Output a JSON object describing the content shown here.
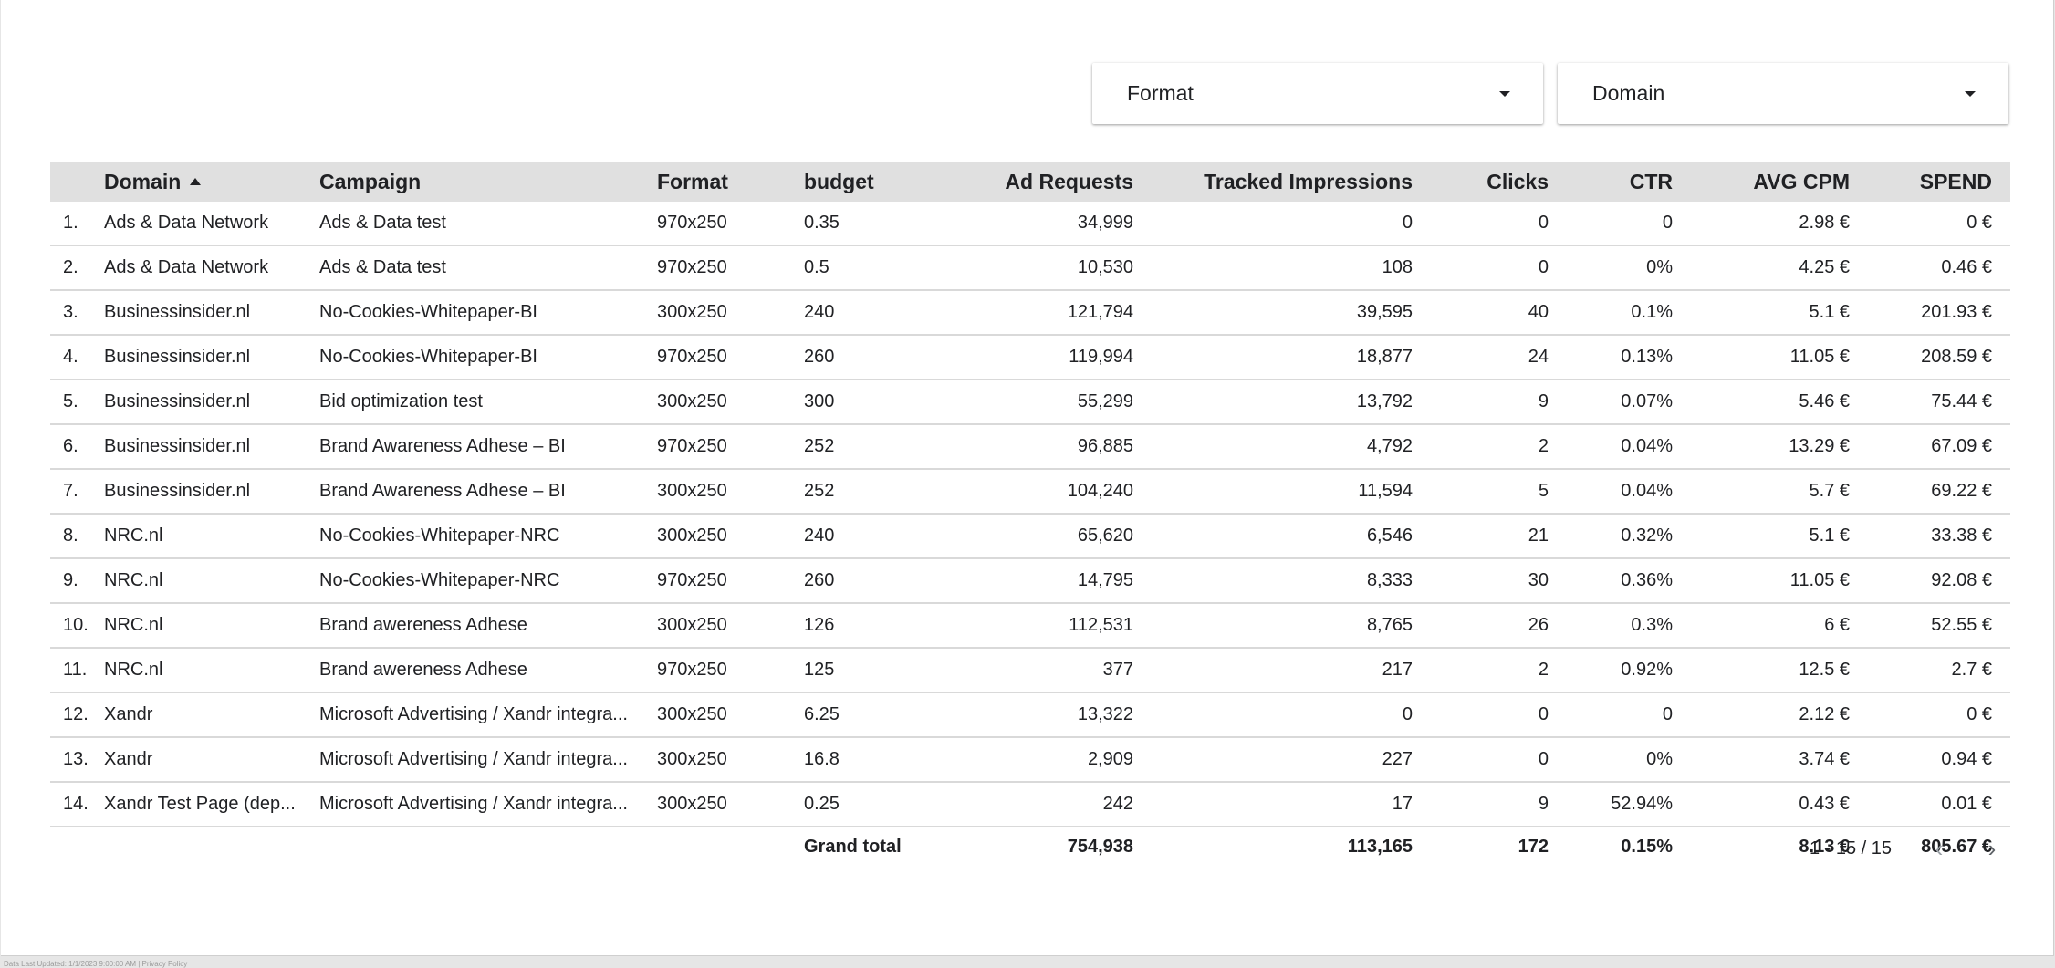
{
  "filters": {
    "format_label": "Format",
    "domain_label": "Domain"
  },
  "table": {
    "columns": {
      "domain": "Domain",
      "campaign": "Campaign",
      "format": "Format",
      "budget": "budget",
      "ad_requests": "Ad Requests",
      "tracked_impressions": "Tracked Impressions",
      "clicks": "Clicks",
      "ctr": "CTR",
      "avg_cpm": "AVG CPM",
      "spend": "SPEND"
    },
    "sort": {
      "column": "Domain",
      "direction": "ascending"
    },
    "rows": [
      {
        "idx": "1.",
        "domain": "Ads & Data Network",
        "campaign": "Ads & Data test",
        "format": "970x250",
        "budget": "0.35",
        "req": "34,999",
        "imp": "0",
        "clicks": "0",
        "ctr": "0",
        "cpm": "2.98 €",
        "spend": "0 €"
      },
      {
        "idx": "2.",
        "domain": "Ads & Data Network",
        "campaign": "Ads & Data test",
        "format": "970x250",
        "budget": "0.5",
        "req": "10,530",
        "imp": "108",
        "clicks": "0",
        "ctr": "0%",
        "cpm": "4.25 €",
        "spend": "0.46 €"
      },
      {
        "idx": "3.",
        "domain": "Businessinsider.nl",
        "campaign": "No-Cookies-Whitepaper-BI",
        "format": "300x250",
        "budget": "240",
        "req": "121,794",
        "imp": "39,595",
        "clicks": "40",
        "ctr": "0.1%",
        "cpm": "5.1 €",
        "spend": "201.93 €"
      },
      {
        "idx": "4.",
        "domain": "Businessinsider.nl",
        "campaign": "No-Cookies-Whitepaper-BI",
        "format": "970x250",
        "budget": "260",
        "req": "119,994",
        "imp": "18,877",
        "clicks": "24",
        "ctr": "0.13%",
        "cpm": "11.05 €",
        "spend": "208.59 €"
      },
      {
        "idx": "5.",
        "domain": "Businessinsider.nl",
        "campaign": "Bid optimization test",
        "format": "300x250",
        "budget": "300",
        "req": "55,299",
        "imp": "13,792",
        "clicks": "9",
        "ctr": "0.07%",
        "cpm": "5.46 €",
        "spend": "75.44 €"
      },
      {
        "idx": "6.",
        "domain": "Businessinsider.nl",
        "campaign": "Brand Awareness Adhese – BI",
        "format": "970x250",
        "budget": "252",
        "req": "96,885",
        "imp": "4,792",
        "clicks": "2",
        "ctr": "0.04%",
        "cpm": "13.29 €",
        "spend": "67.09 €"
      },
      {
        "idx": "7.",
        "domain": "Businessinsider.nl",
        "campaign": "Brand Awareness Adhese – BI",
        "format": "300x250",
        "budget": "252",
        "req": "104,240",
        "imp": "11,594",
        "clicks": "5",
        "ctr": "0.04%",
        "cpm": "5.7 €",
        "spend": "69.22 €"
      },
      {
        "idx": "8.",
        "domain": "NRC.nl",
        "campaign": "No-Cookies-Whitepaper-NRC",
        "format": "300x250",
        "budget": "240",
        "req": "65,620",
        "imp": "6,546",
        "clicks": "21",
        "ctr": "0.32%",
        "cpm": "5.1 €",
        "spend": "33.38 €"
      },
      {
        "idx": "9.",
        "domain": "NRC.nl",
        "campaign": "No-Cookies-Whitepaper-NRC",
        "format": "970x250",
        "budget": "260",
        "req": "14,795",
        "imp": "8,333",
        "clicks": "30",
        "ctr": "0.36%",
        "cpm": "11.05 €",
        "spend": "92.08 €"
      },
      {
        "idx": "10.",
        "domain": "NRC.nl",
        "campaign": "Brand awereness Adhese",
        "format": "300x250",
        "budget": "126",
        "req": "112,531",
        "imp": "8,765",
        "clicks": "26",
        "ctr": "0.3%",
        "cpm": "6 €",
        "spend": "52.55 €"
      },
      {
        "idx": "11.",
        "domain": "NRC.nl",
        "campaign": "Brand awereness Adhese",
        "format": "970x250",
        "budget": "125",
        "req": "377",
        "imp": "217",
        "clicks": "2",
        "ctr": "0.92%",
        "cpm": "12.5 €",
        "spend": "2.7 €"
      },
      {
        "idx": "12.",
        "domain": "Xandr",
        "campaign": "Microsoft Advertising / Xandr integra...",
        "format": "300x250",
        "budget": "6.25",
        "req": "13,322",
        "imp": "0",
        "clicks": "0",
        "ctr": "0",
        "cpm": "2.12 €",
        "spend": "0 €"
      },
      {
        "idx": "13.",
        "domain": "Xandr",
        "campaign": "Microsoft Advertising / Xandr integra...",
        "format": "300x250",
        "budget": "16.8",
        "req": "2,909",
        "imp": "227",
        "clicks": "0",
        "ctr": "0%",
        "cpm": "3.74 €",
        "spend": "0.94 €"
      },
      {
        "idx": "14.",
        "domain": "Xandr Test Page (dep...",
        "campaign": "Microsoft Advertising / Xandr integra...",
        "format": "300x250",
        "budget": "0.25",
        "req": "242",
        "imp": "17",
        "clicks": "9",
        "ctr": "52.94%",
        "cpm": "0.43 €",
        "spend": "0.01 €"
      }
    ],
    "totals": {
      "label": "Grand total",
      "req": "754,938",
      "imp": "113,165",
      "clicks": "172",
      "ctr": "0.15%",
      "cpm": "8.13 €",
      "spend": "805.67 €"
    }
  },
  "pagination": {
    "range": "1 - 15 / 15",
    "prev_icon": "chevron-left-icon",
    "next_icon": "chevron-right-icon"
  },
  "footer": {
    "note": "Data Last Updated: 1/1/2023 9:00:00 AM | Privacy Policy"
  },
  "colors": {
    "header_bg": "#e0e0e0",
    "row_divider": "#d9d9d9",
    "text": "#202124"
  }
}
